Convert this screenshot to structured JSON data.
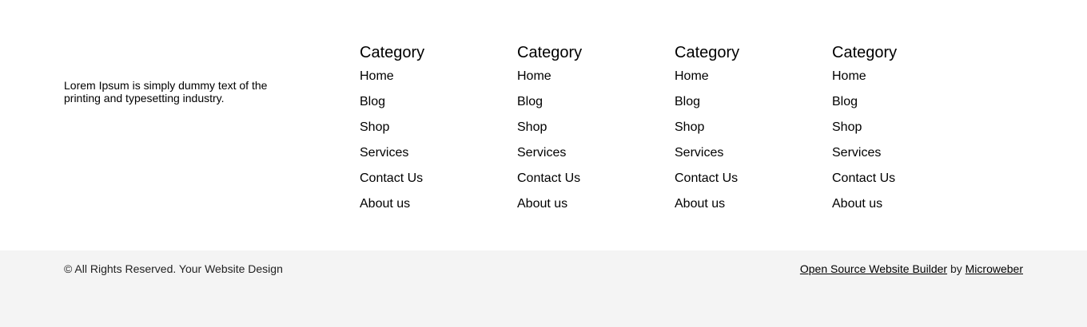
{
  "about": {
    "text": "Lorem Ipsum is simply dummy text of the printing and typesetting industry."
  },
  "columns": [
    {
      "title": "Category",
      "links": [
        "Home",
        "Blog",
        "Shop",
        "Services",
        "Contact Us",
        "About us"
      ]
    },
    {
      "title": "Category",
      "links": [
        "Home",
        "Blog",
        "Shop",
        "Services",
        "Contact Us",
        "About us"
      ]
    },
    {
      "title": "Category",
      "links": [
        "Home",
        "Blog",
        "Shop",
        "Services",
        "Contact Us",
        "About us"
      ]
    },
    {
      "title": "Category",
      "links": [
        "Home",
        "Blog",
        "Shop",
        "Services",
        "Contact Us",
        "About us"
      ]
    }
  ],
  "bottom": {
    "copyright": "© All Rights Reserved. Your Website Design",
    "builder_link": "Open Source Website Builder",
    "by_text": " by ",
    "microweber_link": "Microweber"
  }
}
